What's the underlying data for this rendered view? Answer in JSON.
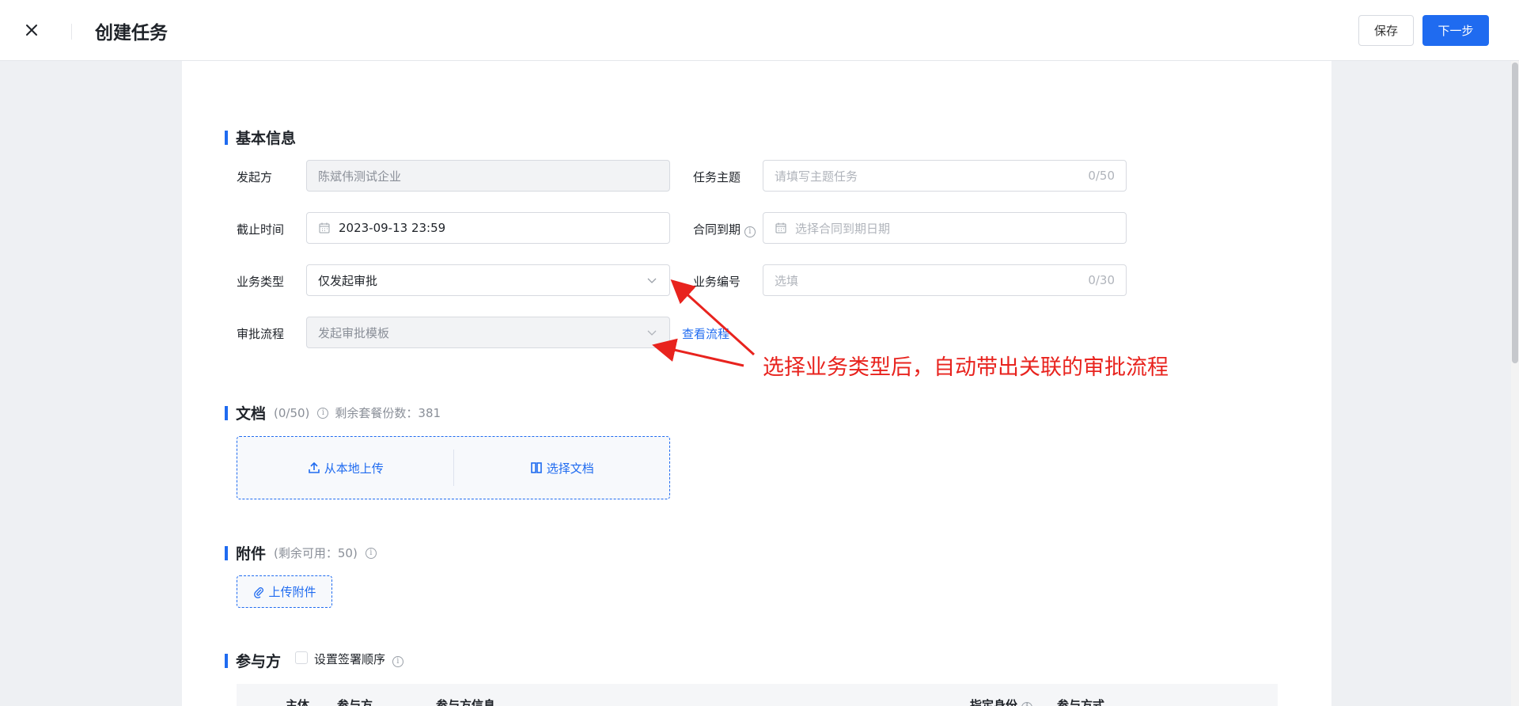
{
  "header": {
    "title": "创建任务",
    "save_label": "保存",
    "next_label": "下一步"
  },
  "basic_info": {
    "section_title": "基本信息",
    "initiator": {
      "label": "发起方",
      "value": "陈斌伟测试企业"
    },
    "task_subject": {
      "label": "任务主题",
      "placeholder": "请填写主题任务",
      "counter": "0/50"
    },
    "deadline": {
      "label": "截止时间",
      "value": "2023-09-13 23:59"
    },
    "contract_expiry": {
      "label": "合同到期",
      "placeholder": "选择合同到期日期"
    },
    "business_type": {
      "label": "业务类型",
      "value": "仅发起审批"
    },
    "business_number": {
      "label": "业务编号",
      "placeholder": "选填",
      "counter": "0/30"
    },
    "approval_flow": {
      "label": "审批流程",
      "value": "发起审批模板",
      "view_link": "查看流程"
    }
  },
  "documents": {
    "section_title": "文档",
    "count": "(0/50)",
    "remaining": "剩余套餐份数：381",
    "upload_local": "从本地上传",
    "select_doc": "选择文档"
  },
  "attachments": {
    "section_title": "附件",
    "remaining": "(剩余可用：50)",
    "upload_label": "上传附件"
  },
  "participants": {
    "section_title": "参与方",
    "sign_order_label": "设置签署顺序",
    "columns": [
      "主体",
      "参与方",
      "参与方信息",
      "指定身份",
      "参与方式"
    ]
  },
  "annotation": "选择业务类型后，自动带出关联的审批流程",
  "colors": {
    "accent": "#1f6bf0",
    "annotation": "#e8231e"
  }
}
